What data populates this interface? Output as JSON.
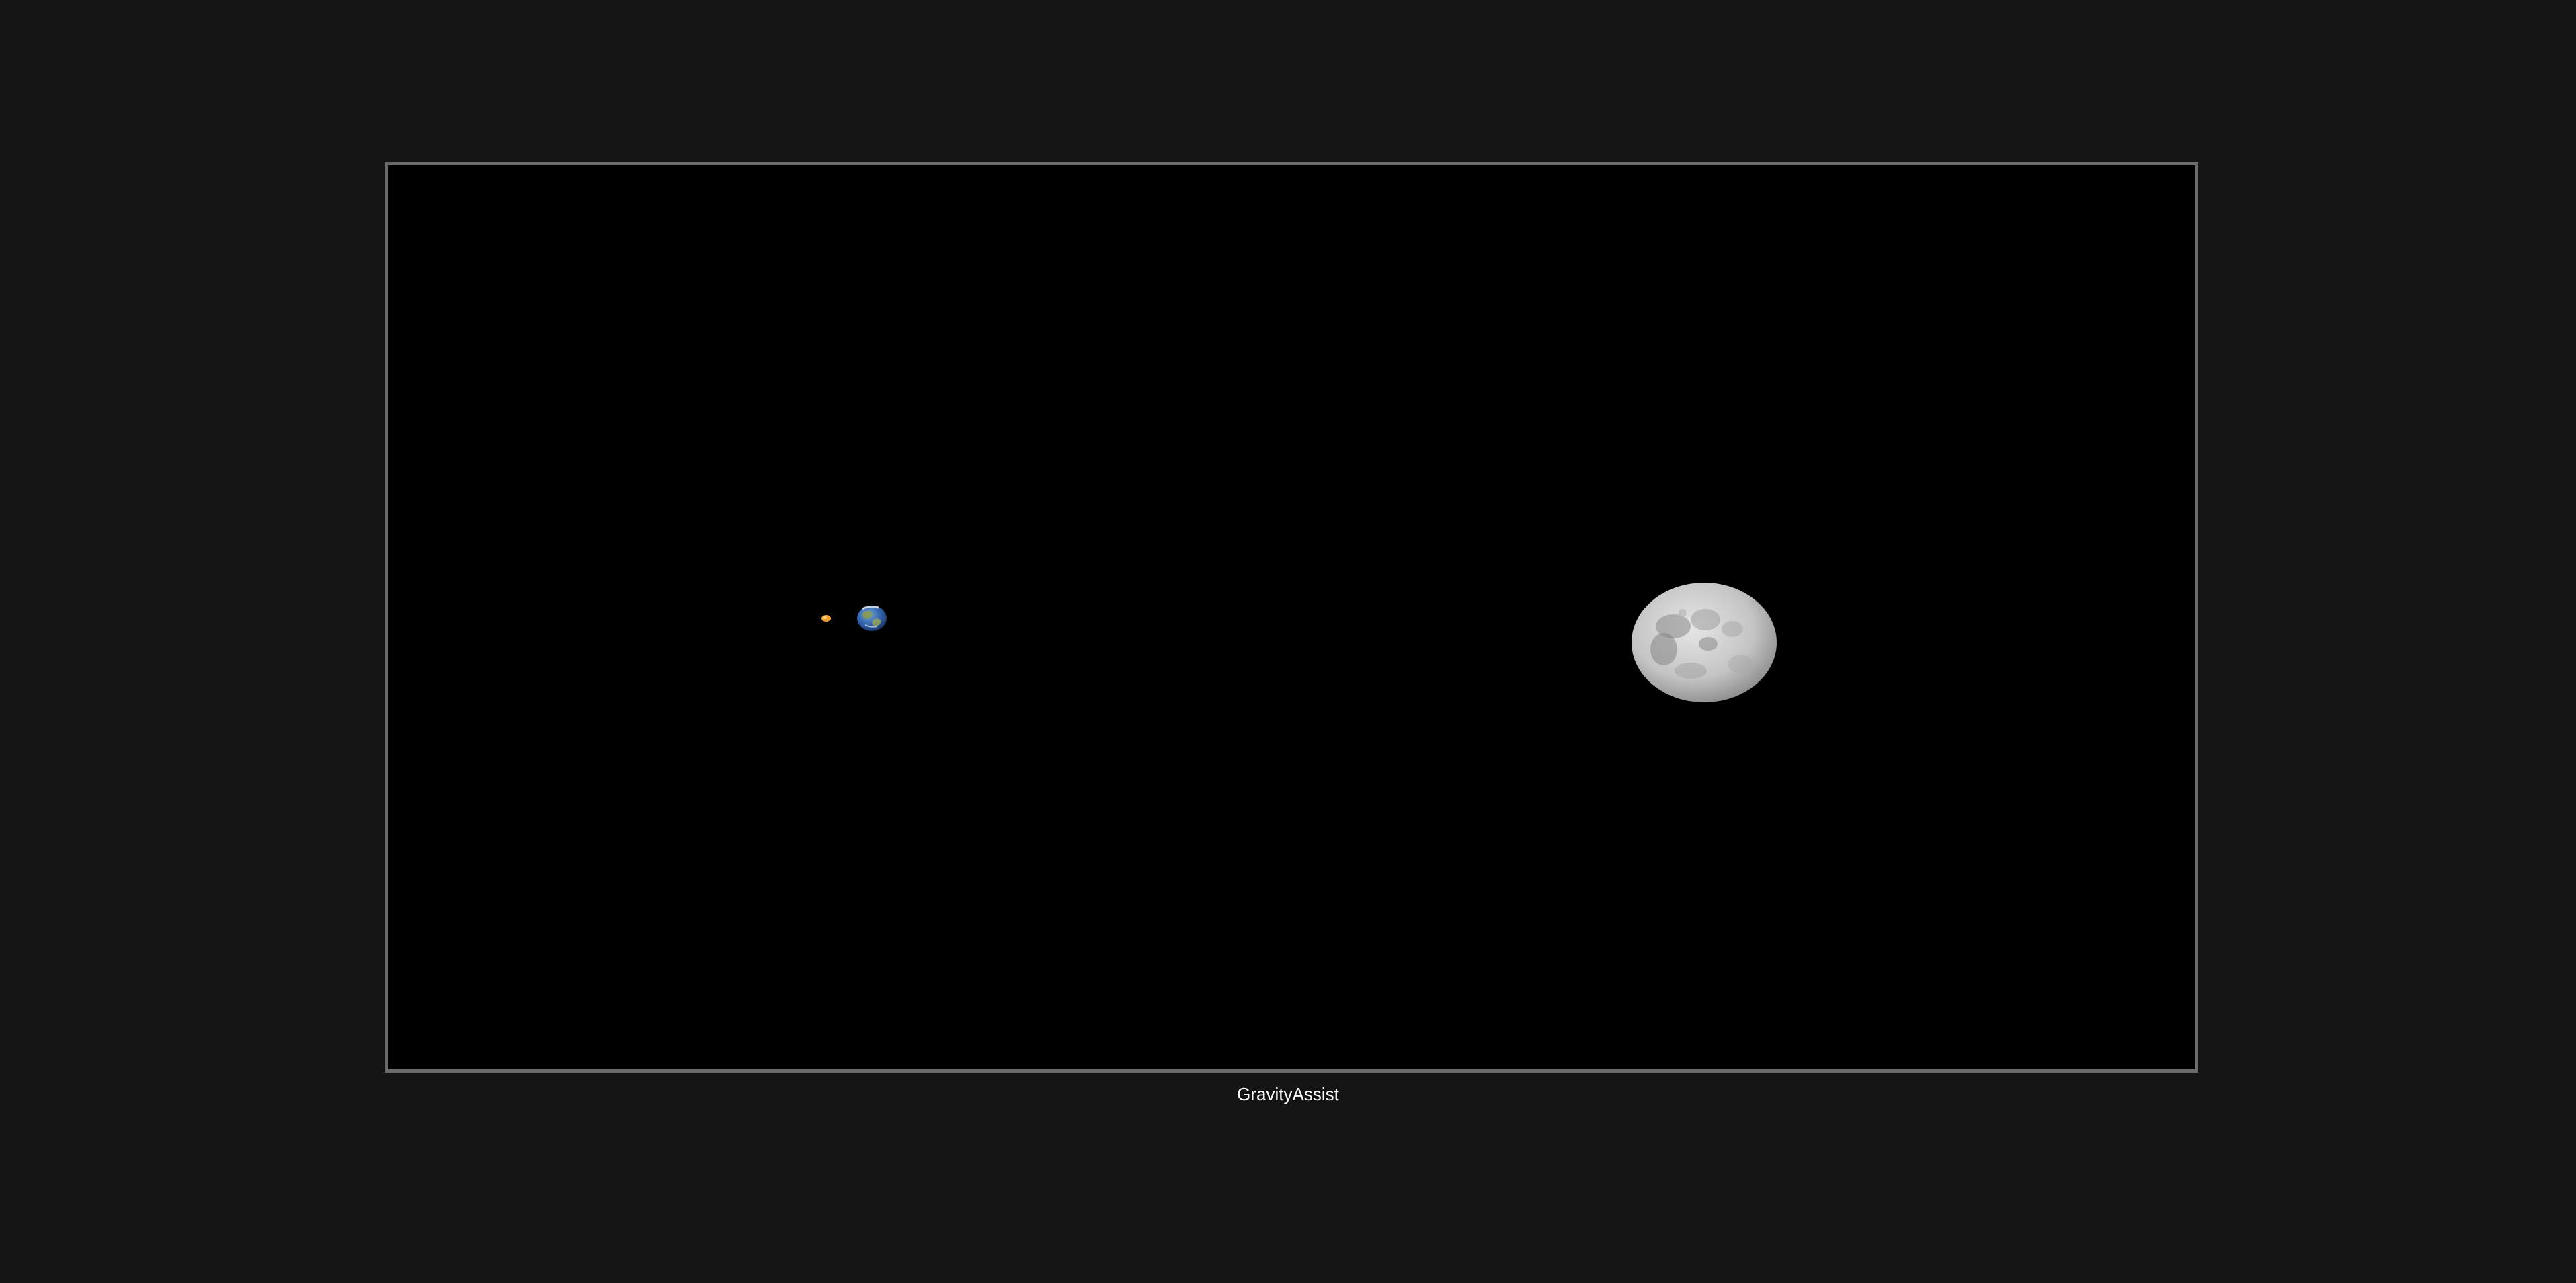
{
  "game": {
    "title": "GravityAssist"
  },
  "scene": {
    "objects": [
      {
        "name": "spacecraft",
        "icon": "spacecraft-icon",
        "color": "#f0a030"
      },
      {
        "name": "earth",
        "icon": "earth-icon",
        "colors": [
          "#2f5fa8",
          "#4a88c8",
          "#8a9a4a",
          "#e8e8e8"
        ]
      },
      {
        "name": "moon",
        "icon": "moon-icon",
        "colors": [
          "#d8d8d8",
          "#a8a8a8",
          "#6e6e6e"
        ]
      }
    ]
  }
}
